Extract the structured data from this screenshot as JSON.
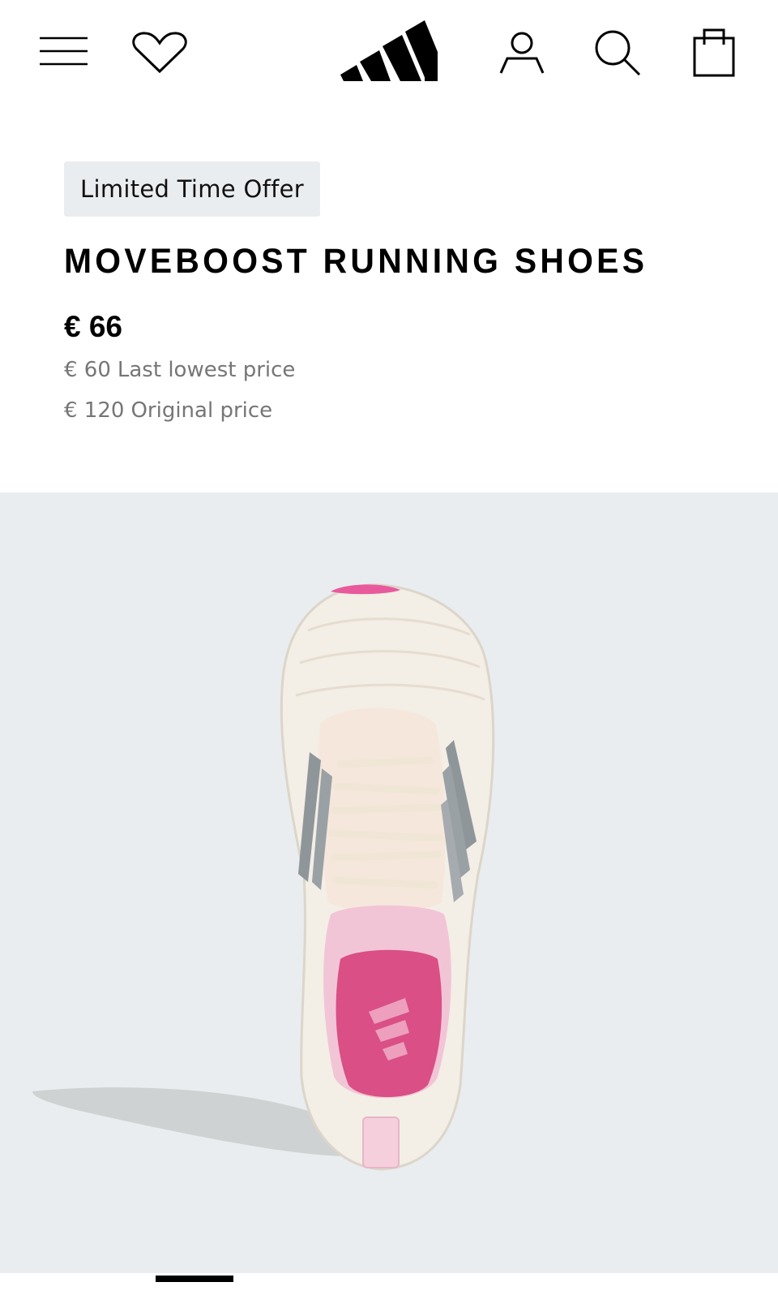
{
  "header": {
    "menu_icon": "hamburger-menu-icon",
    "wishlist_icon": "heart-icon",
    "logo": "adidas-logo",
    "account_icon": "user-icon",
    "search_icon": "search-icon",
    "bag_icon": "shopping-bag-icon"
  },
  "product": {
    "badge": "Limited Time Offer",
    "title": "MOVEBOOST RUNNING SHOES",
    "price": "€ 66",
    "lowest_price_value": "€ 60",
    "lowest_price_label": "Last lowest price",
    "original_price_value": "€ 120",
    "original_price_label": "Original price"
  },
  "gallery": {
    "image": "running-shoe-top-view",
    "active_slide": 1,
    "colors": {
      "background": "#eaedef",
      "shoe": "#f1ece4",
      "accent_pink": "#e8528f",
      "stripes": "#8f969a"
    }
  }
}
